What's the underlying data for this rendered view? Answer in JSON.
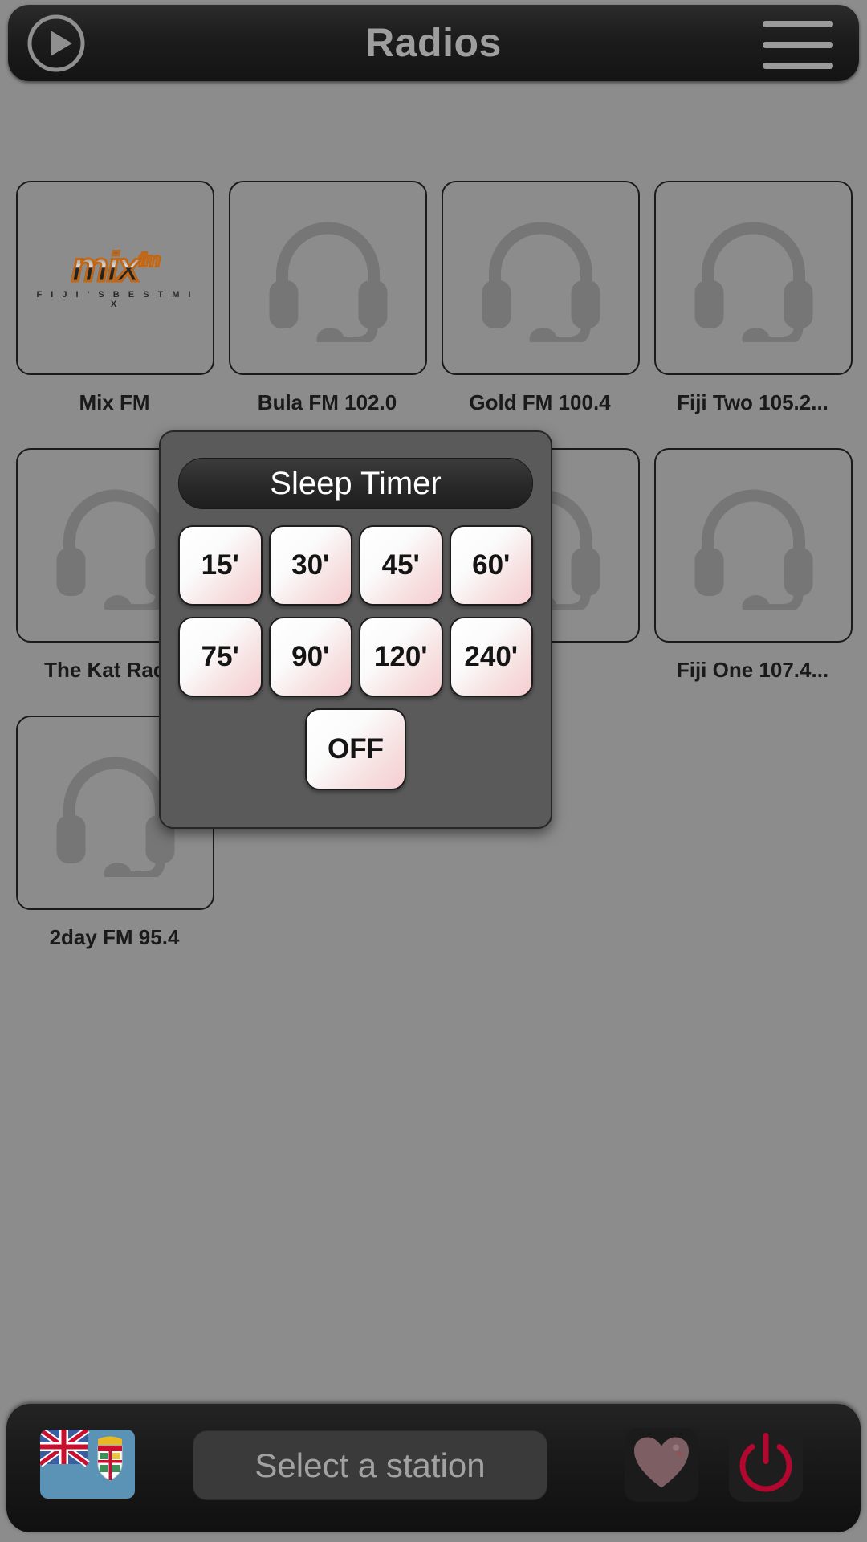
{
  "header": {
    "title": "Radios",
    "play_icon": "play-circle-icon",
    "menu_icon": "hamburger-menu-icon"
  },
  "stations": {
    "rows": [
      [
        {
          "label": "Mix FM",
          "art": "mixfm-logo",
          "logo_word": "mix",
          "logo_sup": "fm",
          "logo_tagline": "F I J I ' S   B E S T   M I X"
        },
        {
          "label": "Bula FM 102.0",
          "art": "headset-placeholder-icon"
        },
        {
          "label": "Gold FM 100.4",
          "art": "headset-placeholder-icon"
        },
        {
          "label": "Fiji Two 105.2...",
          "art": "headset-placeholder-icon"
        }
      ],
      [
        {
          "label": "The Kat Radio",
          "art": "headset-placeholder-icon"
        },
        {
          "label": "",
          "art": "headset-placeholder-icon"
        },
        {
          "label": "",
          "art": "headset-placeholder-icon"
        },
        {
          "label": "Fiji One 107.4...",
          "art": "headset-placeholder-icon"
        }
      ],
      [
        {
          "label": "2day FM 95.4",
          "art": "headset-placeholder-icon"
        }
      ]
    ]
  },
  "sleep_timer_dialog": {
    "title": "Sleep Timer",
    "options_row1": [
      "15'",
      "30'",
      "45'",
      "60'"
    ],
    "options_row2": [
      "75'",
      "90'",
      "120'",
      "240'"
    ],
    "off_label": "OFF"
  },
  "bottom_bar": {
    "flag_icon": "fiji-flag-icon",
    "station_placeholder": "Select a station",
    "favorite_icon": "heart-icon",
    "power_icon": "power-icon"
  },
  "colors": {
    "page_background": "#8c8c8c",
    "bar_background": "#1a1a1a",
    "dialog_background": "#5a5a5a",
    "title_text": "#9e9e9e",
    "timer_button_accent": "#f6cdd0",
    "power_red": "#b4072f",
    "logo_orange": "#c06818"
  }
}
